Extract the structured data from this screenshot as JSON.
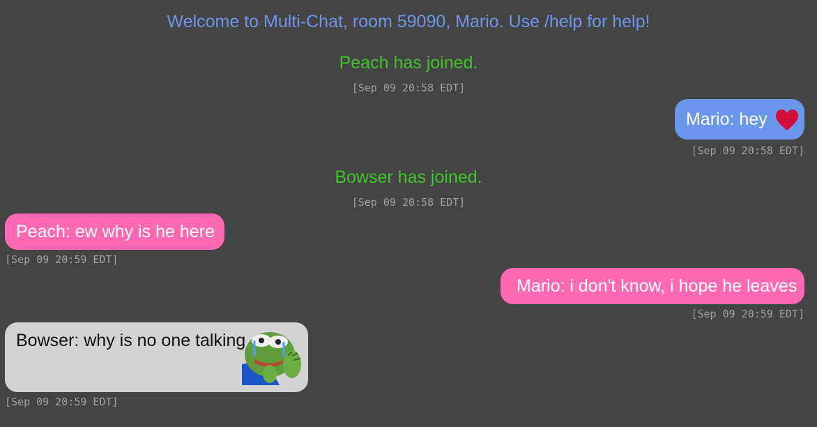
{
  "colors": {
    "background": "#444444",
    "welcome": "#6f95e8",
    "joined": "#3fc42a",
    "timestamp": "#a3a3a3",
    "blue_bubble": "#6a96ec",
    "pink_bubble": "#ff69b4",
    "gray_bubble": "#d3d3d3",
    "heart": "#d10f3a"
  },
  "chat": {
    "welcome": "Welcome to Multi-Chat, room 59090, Mario. Use /help for help!",
    "events": [
      {
        "type": "system",
        "text": "Peach has joined.",
        "timestamp": "[Sep 09 20:58 EDT]"
      },
      {
        "type": "message",
        "text": "Mario: hey",
        "emoji": "red-heart-icon",
        "timestamp": "[Sep 09 20:58 EDT]"
      },
      {
        "type": "system",
        "text": "Bowser has joined.",
        "timestamp": "[Sep 09 20:58 EDT]"
      },
      {
        "type": "message",
        "text": "Peach:  ew why is he here",
        "timestamp": "[Sep 09 20:59 EDT]"
      },
      {
        "type": "message",
        "text": "Mario:  i don't know, i hope he leaves",
        "timestamp": "[Sep 09 20:59 EDT]"
      },
      {
        "type": "message",
        "text": "Bowser: why is no one talking",
        "emoji": "crying-frog-sticker",
        "timestamp": "[Sep 09 20:59 EDT]"
      }
    ]
  }
}
